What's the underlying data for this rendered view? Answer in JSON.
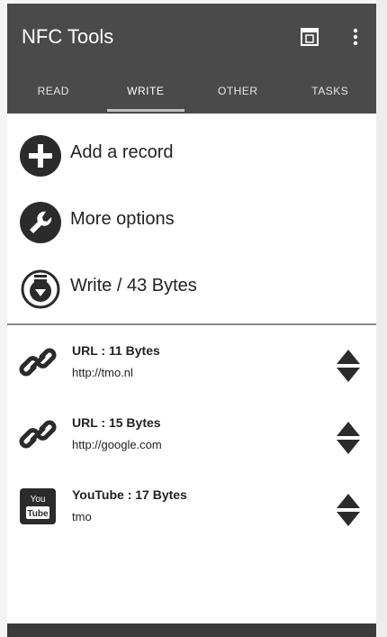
{
  "app": {
    "title": "NFC Tools"
  },
  "tabs": [
    {
      "label": "READ",
      "active": false
    },
    {
      "label": "WRITE",
      "active": true
    },
    {
      "label": "OTHER",
      "active": false
    },
    {
      "label": "TASKS",
      "active": false
    }
  ],
  "menu": {
    "add_record": "Add a record",
    "more_options": "More options",
    "write": "Write / 43 Bytes"
  },
  "records": [
    {
      "type": "URL",
      "title": "URL : 11 Bytes",
      "value": "http://tmo.nl",
      "icon": "link-icon"
    },
    {
      "type": "URL",
      "title": "URL : 15 Bytes",
      "value": "http://google.com",
      "icon": "link-icon"
    },
    {
      "type": "YouTube",
      "title": "YouTube : 17 Bytes",
      "value": "tmo",
      "icon": "youtube-icon",
      "icon_text_top": "You",
      "icon_text_bottom": "Tube"
    }
  ],
  "colors": {
    "appbar": "#4a4a4a",
    "icon": "#2b2b2b",
    "background": "#ffffff"
  }
}
